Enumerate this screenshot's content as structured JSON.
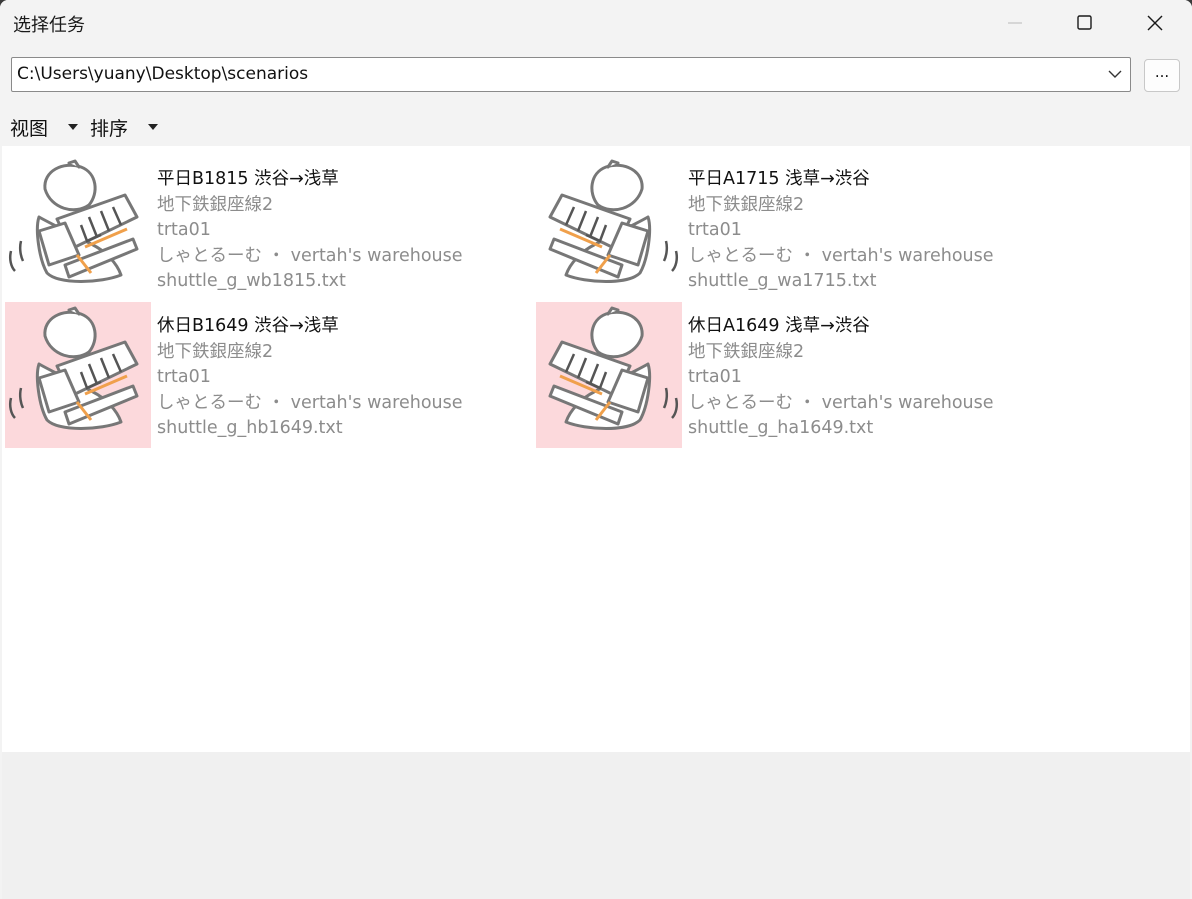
{
  "window": {
    "title": "选择任务",
    "minimize_icon": "minimize-icon",
    "maximize_icon": "maximize-icon",
    "close_icon": "close-icon"
  },
  "path_bar": {
    "value": "C:\\Users\\yuany\\Desktop\\scenarios",
    "dropdown_icon": "chevron-down-icon",
    "browse_label": "..."
  },
  "toolbar": {
    "view_label": "视图",
    "sort_label": "排序"
  },
  "colors": {
    "thumb_highlight": "#fcd9dc",
    "secondary_text": "#8c8c8c",
    "accent_orange": "#f0a04b"
  },
  "items": [
    {
      "title": "平日B1815 渋谷→浅草",
      "route": "地下鉄銀座線2",
      "code": "trta01",
      "author": "しゃとるーむ ・ vertah's warehouse",
      "file": "shuttle_g_wb1815.txt",
      "highlighted": false,
      "icon": "character-thumbnail-icon"
    },
    {
      "title": "平日A1715 浅草→渋谷",
      "route": "地下鉄銀座線2",
      "code": "trta01",
      "author": "しゃとるーむ ・ vertah's warehouse",
      "file": "shuttle_g_wa1715.txt",
      "highlighted": false,
      "icon": "character-thumbnail-icon"
    },
    {
      "title": "休日B1649 渋谷→浅草",
      "route": "地下鉄銀座線2",
      "code": "trta01",
      "author": "しゃとるーむ ・ vertah's warehouse",
      "file": "shuttle_g_hb1649.txt",
      "highlighted": true,
      "icon": "character-thumbnail-icon"
    },
    {
      "title": "休日A1649 浅草→渋谷",
      "route": "地下鉄銀座線2",
      "code": "trta01",
      "author": "しゃとるーむ ・ vertah's warehouse",
      "file": "shuttle_g_ha1649.txt",
      "highlighted": true,
      "icon": "character-thumbnail-icon"
    }
  ]
}
